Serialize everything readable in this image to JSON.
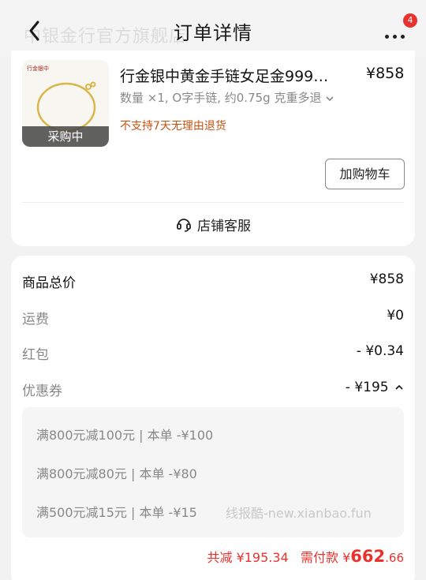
{
  "header": {
    "shop_name_faded": "中银金行官方旗舰店",
    "title": "订单详情",
    "badge_count": "4"
  },
  "product": {
    "thumb_logo": "行金银中",
    "thumb_tag": "采购中",
    "name": "行金银中黄金手链女足金999…",
    "price": "¥858",
    "spec": "数量 ×1, O字手链, 约0.75g 克重多退",
    "return_policy": "不支持7天无理由退货",
    "add_cart_label": "加购物车"
  },
  "service": {
    "label": "店铺客服"
  },
  "price_detail": {
    "rows": [
      {
        "label": "商品总价",
        "value": "¥858"
      },
      {
        "label": "运费",
        "value": "¥0"
      },
      {
        "label": "红包",
        "value": "- ¥0.34"
      },
      {
        "label": "优惠券",
        "value": "- ¥195"
      }
    ],
    "coupons": [
      "满800元减100元 | 本单 -¥100",
      "满800元减80元 | 本单 -¥80",
      "满500元减15元 | 本单 -¥15"
    ],
    "watermark": "线报酷-new.xianbao.fun",
    "summary": {
      "discount_label": "共减",
      "discount_value": "¥195.34",
      "pay_label": "需付款",
      "pay_currency": "¥",
      "pay_int": "662",
      "pay_dec": ".66"
    }
  },
  "colors": {
    "accent_red": "#e8322e",
    "warning_orange": "#c8520f"
  }
}
